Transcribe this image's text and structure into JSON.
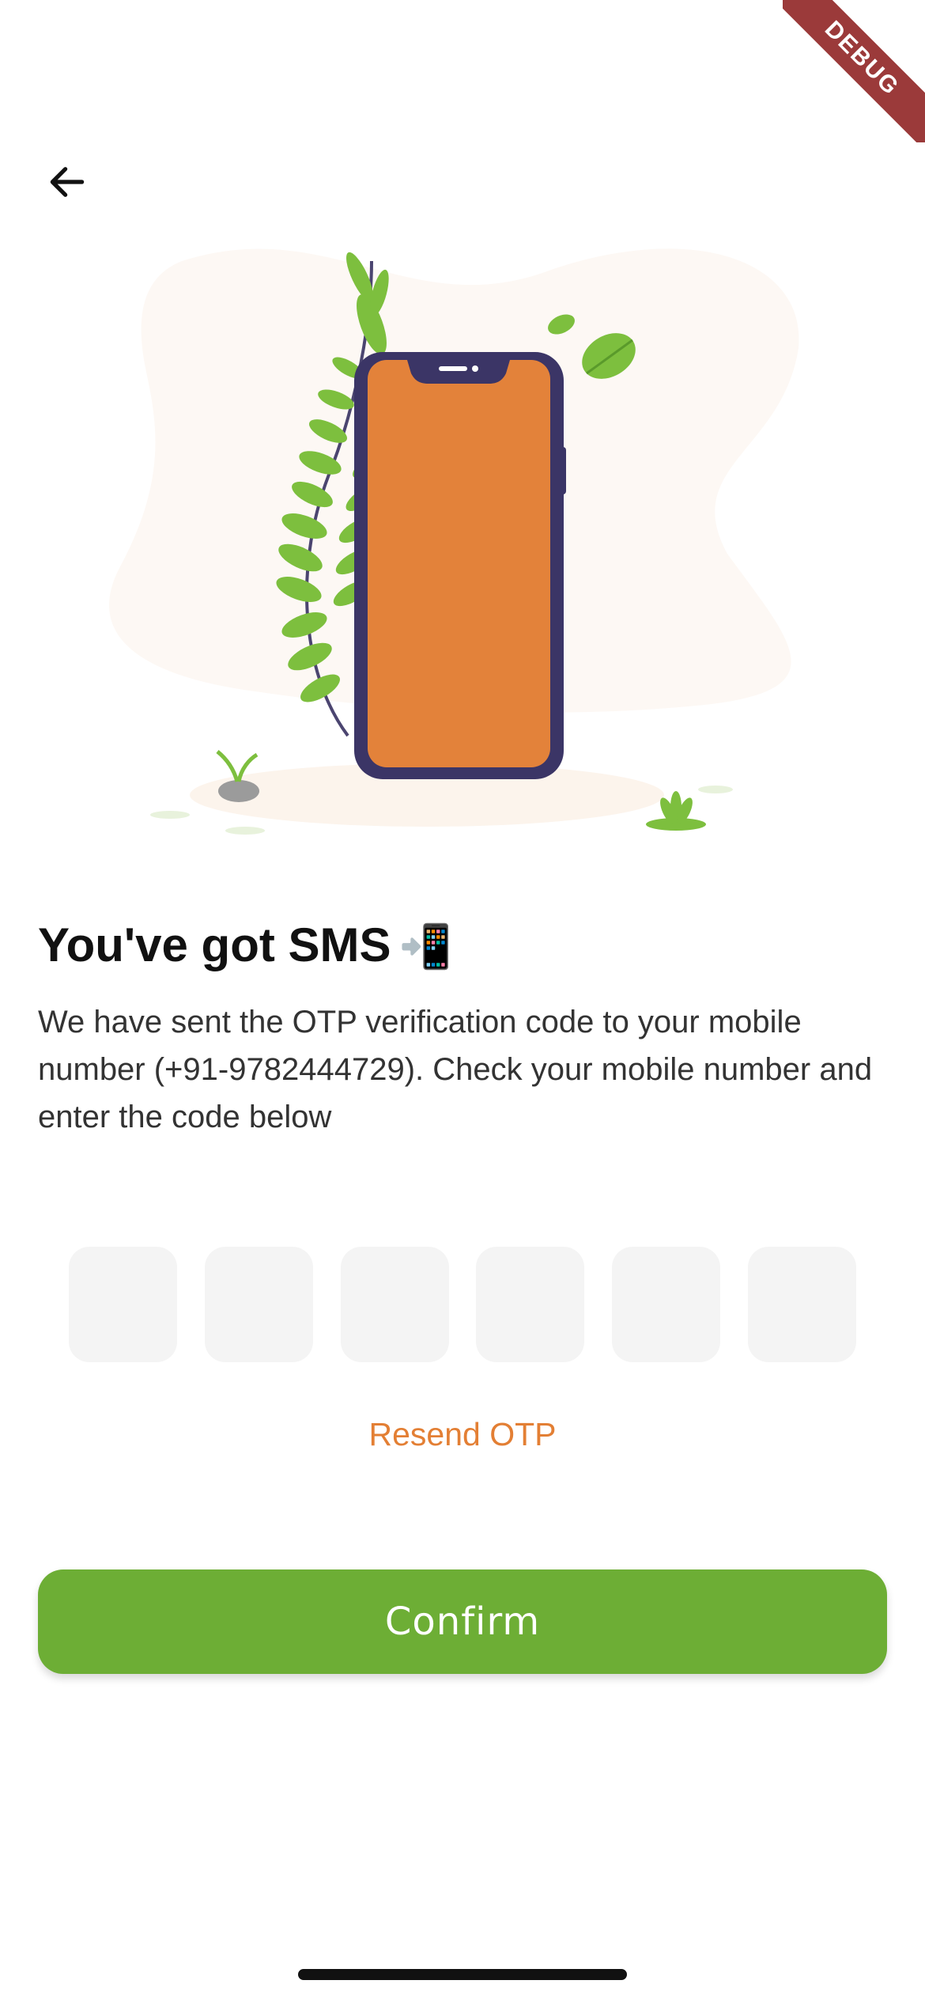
{
  "debug_label": "DEBUG",
  "header": {
    "back_icon": "arrow-left-icon"
  },
  "title": "You've got SMS",
  "title_emoji": "📲",
  "description": "We have sent the OTP verification code to your mobile number (+91-9782444729). Check your mobile number and enter the code below",
  "otp": {
    "digits": [
      "",
      "",
      "",
      "",
      "",
      ""
    ]
  },
  "resend_label": "Resend OTP",
  "confirm_label": "Confirm",
  "colors": {
    "accent_green": "#6dae35",
    "accent_orange": "#e37f34",
    "phone_frame": "#3b3566",
    "phone_screen": "#e3823a"
  }
}
